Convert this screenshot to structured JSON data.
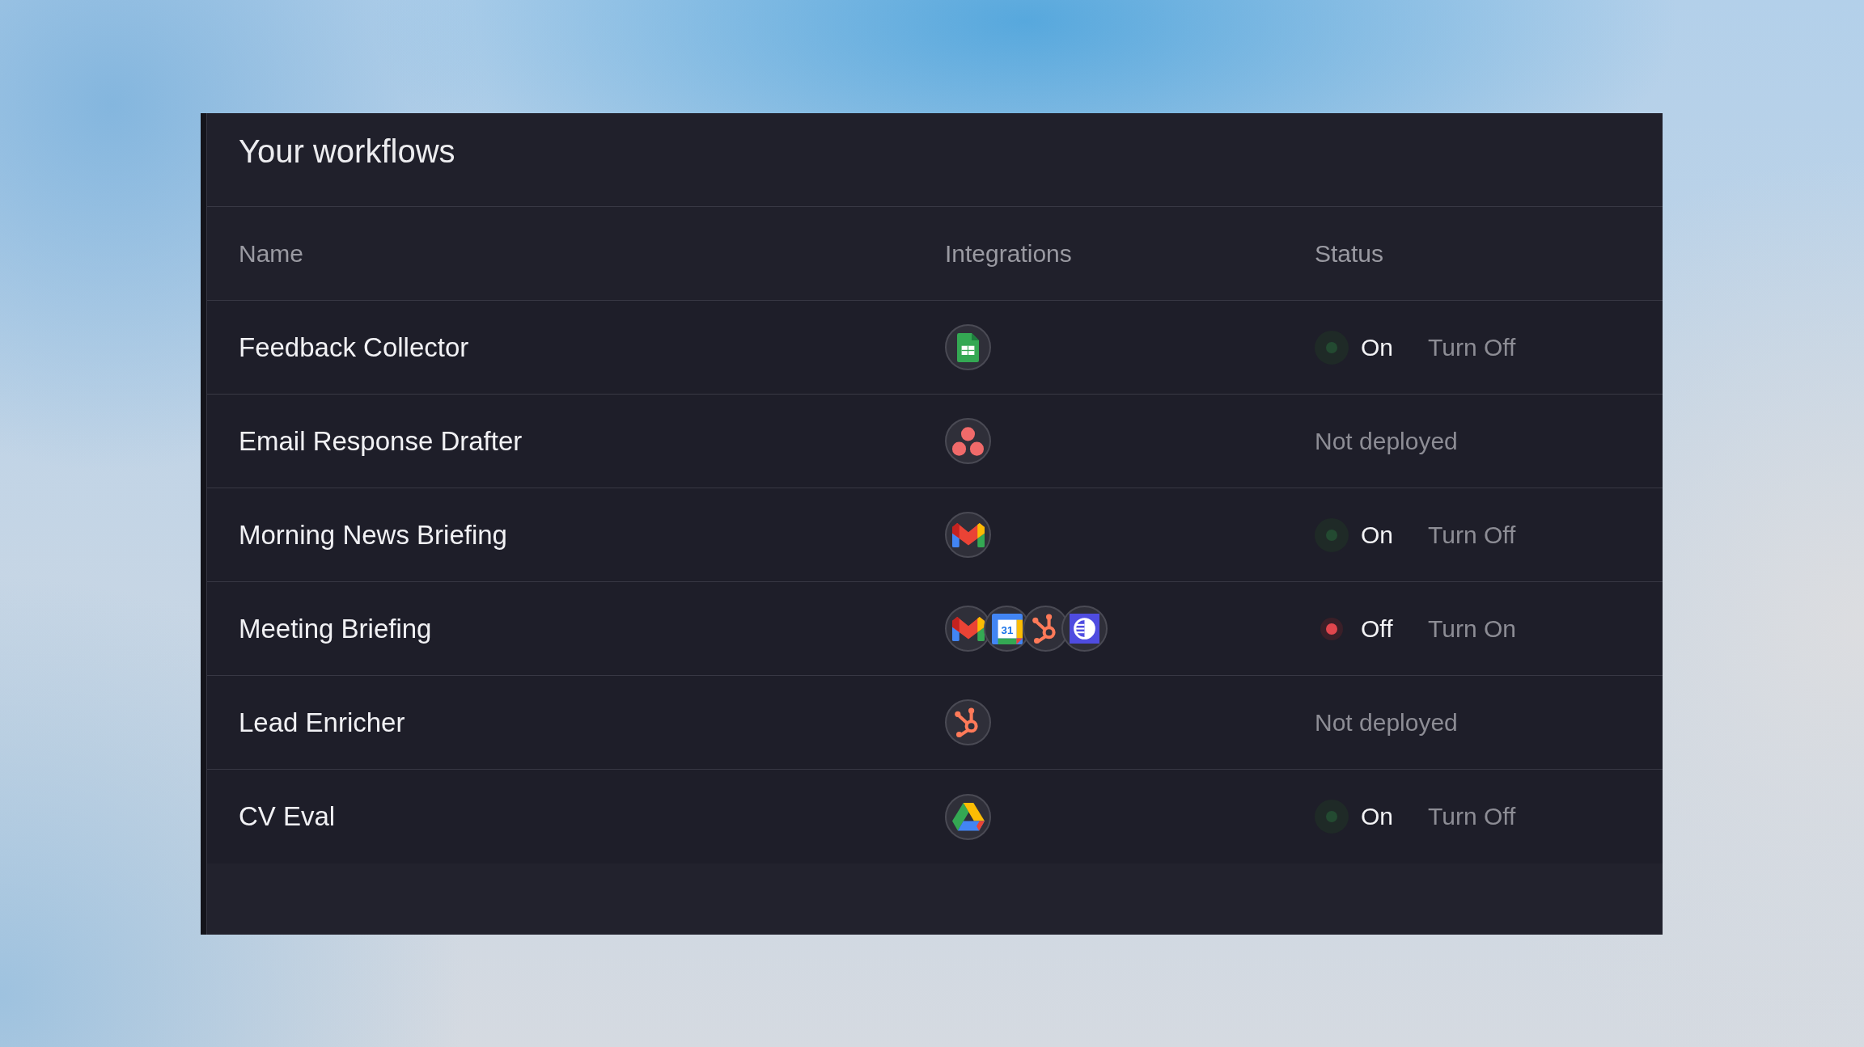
{
  "title": "Your workflows",
  "table": {
    "columns": [
      "Name",
      "Integrations",
      "Status"
    ],
    "rows": [
      {
        "name": "Feedback Collector",
        "integrations": [
          {
            "kind": "sheet"
          }
        ],
        "status": {
          "kind": "on",
          "label": "On",
          "action": "Turn Off",
          "color": "#234a31"
        }
      },
      {
        "name": "Email Response Drafter",
        "integrations": [
          {
            "kind": "dots"
          }
        ],
        "status": {
          "kind": "not_deployed",
          "label": "Not deployed"
        }
      },
      {
        "name": "Morning News Briefing",
        "integrations": [
          {
            "kind": "mail"
          }
        ],
        "status": {
          "kind": "on",
          "label": "On",
          "action": "Turn Off",
          "color": "#234a31"
        }
      },
      {
        "name": "Meeting Briefing",
        "integrations": [
          {
            "kind": "mail"
          },
          {
            "kind": "calendar",
            "text": "31"
          },
          {
            "kind": "hub"
          },
          {
            "kind": "disc"
          }
        ],
        "status": {
          "kind": "off",
          "label": "Off",
          "action": "Turn On",
          "color": "#e0464d"
        }
      },
      {
        "name": "Lead Enricher",
        "integrations": [
          {
            "kind": "hub"
          }
        ],
        "status": {
          "kind": "not_deployed",
          "label": "Not deployed"
        }
      },
      {
        "name": "CV Eval",
        "integrations": [
          {
            "kind": "drive"
          }
        ],
        "status": {
          "kind": "on",
          "label": "On",
          "action": "Turn Off",
          "color": "#234a31"
        }
      }
    ]
  }
}
